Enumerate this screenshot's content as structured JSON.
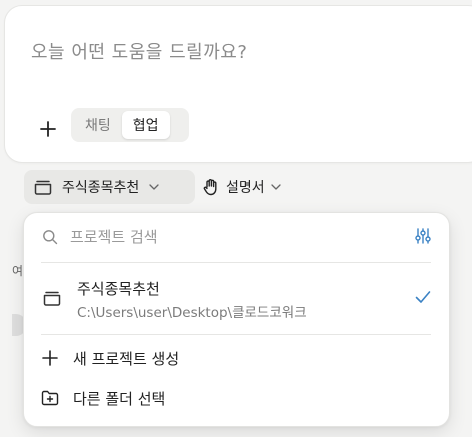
{
  "composer": {
    "placeholder": "오늘 어떤 도움을 드릴까요?",
    "modes": [
      {
        "label": "채팅",
        "active": false
      },
      {
        "label": "협업",
        "active": true
      }
    ]
  },
  "toolbar": {
    "project_label": "주식종목추천",
    "guide_label": "설명서"
  },
  "background": {
    "fragment": "여"
  },
  "dropdown": {
    "search_placeholder": "프로젝트 검색",
    "project": {
      "name": "주식종목추천",
      "path": "C:\\Users\\user\\Desktop\\클로드코워크",
      "selected": true
    },
    "new_project_label": "새 프로젝트 생성",
    "choose_folder_label": "다른 폴더 선택"
  },
  "colors": {
    "accent": "#3b82c4",
    "chip_bg": "#e8e8e6",
    "page_bg": "#f4f4f3"
  }
}
